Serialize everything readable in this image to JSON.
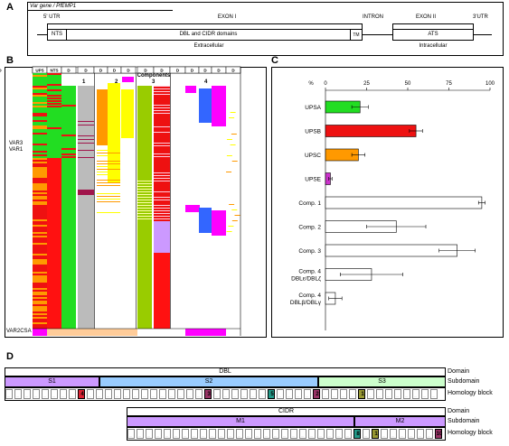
{
  "panel_a": {
    "label": "A",
    "title": "Var gene / PfEMP1",
    "utr5": "5' UTR",
    "exon1": "EXON I",
    "nts": "NTS",
    "dbl_cidr": "DBL and CIDR domains",
    "tm": "TM",
    "extracellular": "Extracellular",
    "intron": "INTRON",
    "exon2": "EXON II",
    "ats": "ATS",
    "intracellular": "Intracellular",
    "utr3": "3'UTR"
  },
  "panel_b": {
    "label": "B",
    "header_cols": [
      "UPS",
      "NTS",
      "D",
      "D",
      "D",
      "D",
      "D",
      "D",
      "D",
      "D",
      "D",
      "D",
      "D",
      "D",
      "D"
    ],
    "components_title": "Components",
    "component_numbers": [
      "1",
      "2",
      "3",
      "4"
    ],
    "row_labels": [
      "VAR3",
      "VAR1"
    ],
    "bottom_label": "VAR2CSA",
    "colors": {
      "upsa": "#22dd22",
      "upsb": "#ee1111",
      "upsc": "#ff9900",
      "upse": "#cc33cc",
      "comp1": "#bbbbbb",
      "comp2": "#ffff00",
      "comp3": "#99cc00",
      "comp3b": "#cc99ff",
      "comp4a": "#ff00ff",
      "comp4b": "#3366ff"
    }
  },
  "panel_c": {
    "label": "C",
    "chart_data": {
      "type": "bar",
      "orientation": "horizontal",
      "xlabel": "%",
      "xlim": [
        0,
        100
      ],
      "xticks": [
        "0",
        "25",
        "50",
        "75",
        "100"
      ],
      "categories": [
        "UPSA",
        "UPSB",
        "UPSC",
        "UPSE",
        "Comp. 1",
        "Comp. 2",
        "Comp. 3",
        "Comp. 4\nDBLε/DBLζ",
        "Comp. 4\nDBLβ/DBLγ"
      ],
      "category_lines": [
        [
          "UPSA"
        ],
        [
          "UPSB"
        ],
        [
          "UPSC"
        ],
        [
          "UPSE"
        ],
        [
          "Comp. 1"
        ],
        [
          "Comp. 2"
        ],
        [
          "Comp. 3"
        ],
        [
          "Comp. 4",
          "DBLε/DBLζ"
        ],
        [
          "Comp. 4",
          "DBLβ/DBLγ"
        ]
      ],
      "values": [
        21,
        55,
        20,
        3,
        95,
        43,
        80,
        28,
        6
      ],
      "errors": [
        5,
        4,
        4,
        1,
        2,
        18,
        11,
        19,
        4
      ],
      "colors": [
        "#22dd22",
        "#ee1111",
        "#ff9900",
        "#cc33cc",
        "#ffffff",
        "#ffffff",
        "#ffffff",
        "#ffffff",
        "#ffffff"
      ]
    }
  },
  "panel_d": {
    "label": "D",
    "row_labels_top": [
      "Domain",
      "Subdomain",
      "Homology block"
    ],
    "row_labels_bottom": [
      "Domain",
      "Subdomain",
      "Homology block"
    ],
    "dbl_title": "DBL",
    "dbl_subdomains": [
      "S1",
      "S2",
      "S3"
    ],
    "dbl_numbers": [
      "4",
      "3",
      "5",
      "2",
      "1"
    ],
    "cidr_title": "CIDR",
    "cidr_subdomains": [
      "M1",
      "M2"
    ],
    "cidr_numbers": [
      "8",
      "1",
      "10"
    ],
    "dots": "..."
  }
}
